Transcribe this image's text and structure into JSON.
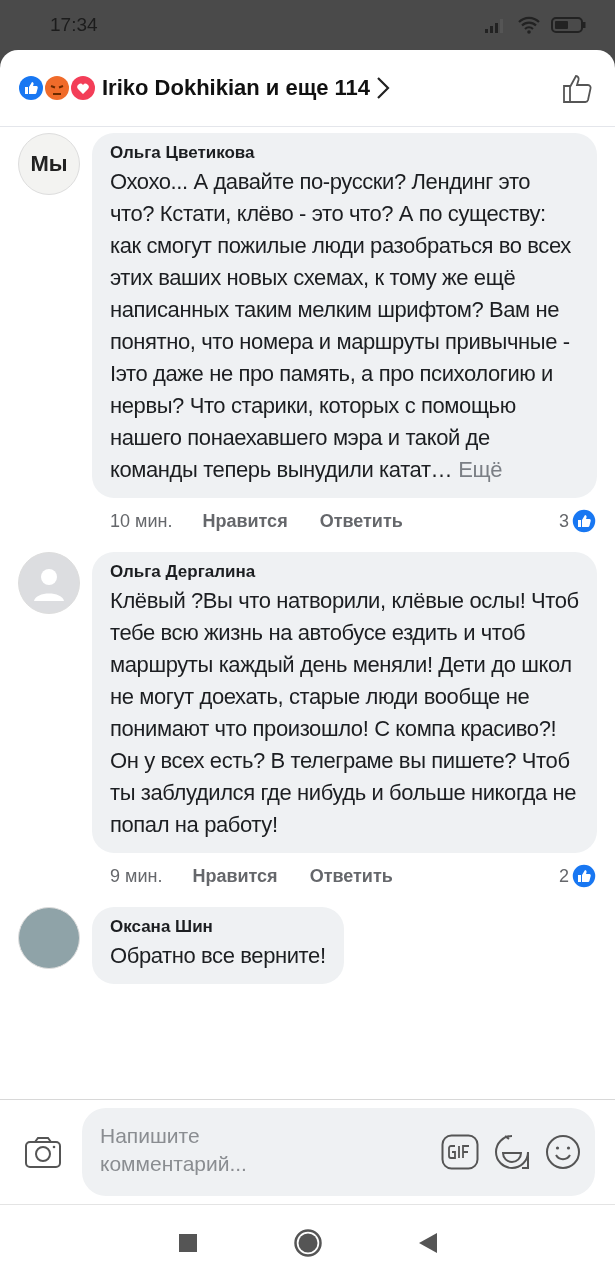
{
  "status_bar": {
    "time": "17:34"
  },
  "header": {
    "reactors": "Iriko Dokhikian и еще 114"
  },
  "comments": [
    {
      "avatar": {
        "kind": "logo",
        "text": "Мы"
      },
      "author": "Ольга Цветикова",
      "text": "Охохо... А давайте по-русски? Лендинг это что? Кстати, клёво - это что? А по существу: как смогут пожилые люди разобраться во всех этих ваших новых схемах, к тому же ещё написанных таким мелким шрифтом? Вам не понятно, что номера и маршруты привычные - Iэто даже не про память, а про психологию и нервы? Что старики, которых с помощью нашего понаехавшего мэра и такой де команды теперь вынудили катат…",
      "more": "Ещё",
      "time": "10 мин.",
      "like": "Нравится",
      "reply": "Ответить",
      "reactions": "3"
    },
    {
      "avatar": {
        "kind": "default"
      },
      "author": "Ольга Дергалина",
      "text": "Клёвый ?Вы что натворили, клёвые ослы! Чтоб тебе всю жизнь на автобусе ездить и чтоб маршруты каждый день меняли! Дети до школ не могут доехать, старые люди вообще не понимают что произошло! С компа красиво?! Он у всех есть? В телеграме вы пишете? Чтоб ты заблудился где нибудь и больше никогда не попал на работу!",
      "time": "9 мин.",
      "like": "Нравится",
      "reply": "Ответить",
      "reactions": "2"
    },
    {
      "avatar": {
        "kind": "photo"
      },
      "author": "Оксана Шин",
      "text": "Обратно все верните!"
    }
  ],
  "composer": {
    "placeholder": "Напишите комментарий..."
  }
}
